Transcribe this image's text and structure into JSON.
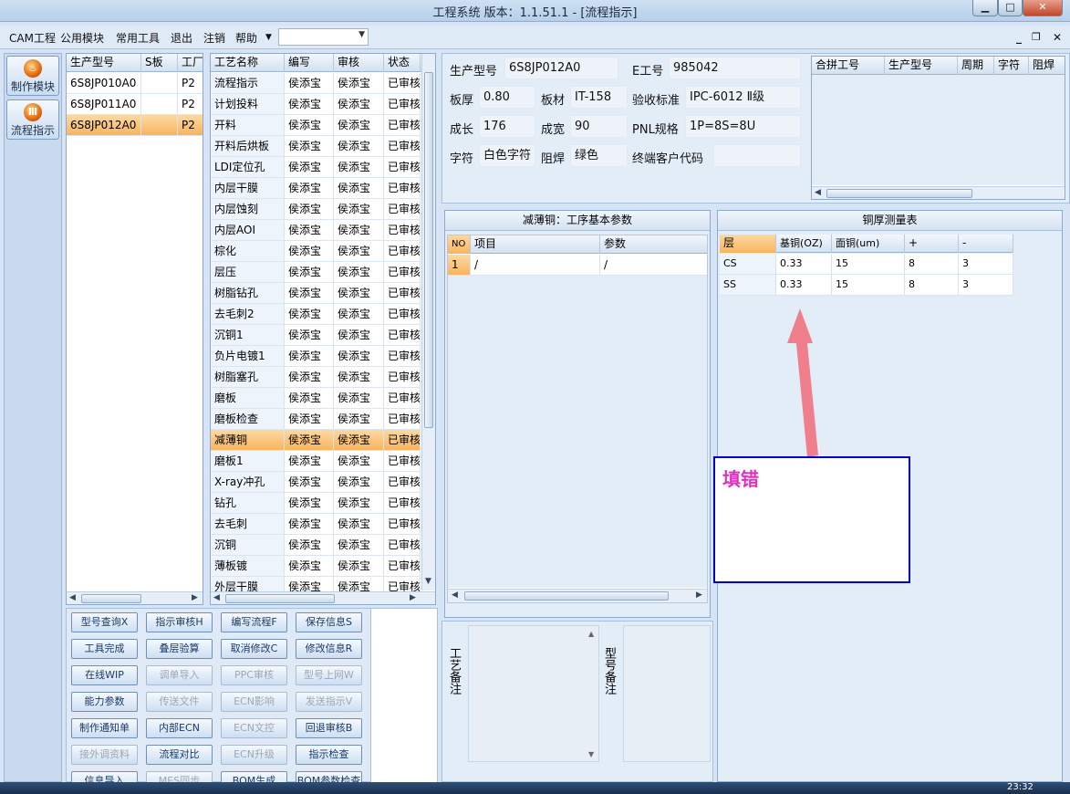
{
  "window": {
    "title": "工程系统  版本：1.1.51.1 - [流程指示]"
  },
  "menu": {
    "items": [
      "CAM工程",
      "公用模块",
      "常用工具",
      "退出",
      "注销",
      "帮助"
    ],
    "combo_value": ""
  },
  "nav": {
    "items": [
      "制作模块",
      "流程指示"
    ]
  },
  "model_grid": {
    "headers": [
      "生产型号",
      "S板",
      "工厂"
    ],
    "rows": [
      [
        "6S8JP010A0",
        "",
        "P2"
      ],
      [
        "6S8JP011A0",
        "",
        "P2"
      ],
      [
        "6S8JP012A0",
        "",
        "P2"
      ]
    ],
    "selected_index": 2
  },
  "process_grid": {
    "headers": [
      "工艺名称",
      "编写",
      "审核",
      "状态"
    ],
    "rows": [
      [
        "流程指示",
        "侯添宝",
        "侯添宝",
        "已审核"
      ],
      [
        "计划投料",
        "侯添宝",
        "侯添宝",
        "已审核"
      ],
      [
        "开料",
        "侯添宝",
        "侯添宝",
        "已审核"
      ],
      [
        "开料后烘板",
        "侯添宝",
        "侯添宝",
        "已审核"
      ],
      [
        "LDI定位孔",
        "侯添宝",
        "侯添宝",
        "已审核"
      ],
      [
        "内层干膜",
        "侯添宝",
        "侯添宝",
        "已审核"
      ],
      [
        "内层蚀刻",
        "侯添宝",
        "侯添宝",
        "已审核"
      ],
      [
        "内层AOI",
        "侯添宝",
        "侯添宝",
        "已审核"
      ],
      [
        "棕化",
        "侯添宝",
        "侯添宝",
        "已审核"
      ],
      [
        "层压",
        "侯添宝",
        "侯添宝",
        "已审核"
      ],
      [
        "树脂钻孔",
        "侯添宝",
        "侯添宝",
        "已审核"
      ],
      [
        "去毛刺2",
        "侯添宝",
        "侯添宝",
        "已审核"
      ],
      [
        "沉铜1",
        "侯添宝",
        "侯添宝",
        "已审核"
      ],
      [
        "负片电镀1",
        "侯添宝",
        "侯添宝",
        "已审核"
      ],
      [
        "树脂塞孔",
        "侯添宝",
        "侯添宝",
        "已审核"
      ],
      [
        "磨板",
        "侯添宝",
        "侯添宝",
        "已审核"
      ],
      [
        "磨板检查",
        "侯添宝",
        "侯添宝",
        "已审核"
      ],
      [
        "减薄铜",
        "侯添宝",
        "侯添宝",
        "已审核"
      ],
      [
        "磨板1",
        "侯添宝",
        "侯添宝",
        "已审核"
      ],
      [
        "X-ray冲孔",
        "侯添宝",
        "侯添宝",
        "已审核"
      ],
      [
        "钻孔",
        "侯添宝",
        "侯添宝",
        "已审核"
      ],
      [
        "去毛刺",
        "侯添宝",
        "侯添宝",
        "已审核"
      ],
      [
        "沉铜",
        "侯添宝",
        "侯添宝",
        "已审核"
      ],
      [
        "薄板镀",
        "侯添宝",
        "侯添宝",
        "已审核"
      ],
      [
        "外层干膜",
        "侯添宝",
        "侯添宝",
        "已审核"
      ]
    ],
    "selected_index": 17
  },
  "buttons": [
    [
      "型号查询X",
      "指示审核H",
      "编写流程F",
      "保存信息S"
    ],
    [
      "工具完成",
      "叠层验算",
      "取消修改C",
      "修改信息R"
    ],
    [
      "在线WIP",
      "调单导入",
      "PPC审核",
      "型号上网W"
    ],
    [
      "能力参数",
      "传送文件",
      "ECN影响",
      "发送指示V"
    ],
    [
      "制作通知单",
      "内部ECN",
      "ECN文控",
      "回退审核B"
    ],
    [
      "接外调资料",
      "流程对比",
      "ECN升级",
      "指示检查"
    ],
    [
      "信息导入",
      "MES同步",
      "BOM生成",
      "BOM参数检查"
    ]
  ],
  "buttons_disabled": [
    "调单导入",
    "PPC审核",
    "型号上网W",
    "传送文件",
    "ECN影响",
    "发送指示V",
    "ECN文控",
    "接外调资料",
    "ECN升级",
    "MES同步"
  ],
  "info": {
    "model_label": "生产型号",
    "model_value": "6S8JP012A0",
    "e_label": "E工号",
    "e_value": "985042",
    "thickness_label": "板厚",
    "thickness_value": "0.80",
    "material_label": "板材",
    "material_value": "IT-158",
    "standard_label": "验收标准",
    "standard_value": "IPC-6012 Ⅱ级",
    "length_label": "成长",
    "length_value": "176",
    "width_label": "成宽",
    "width_value": "90",
    "pnl_label": "PNL规格",
    "pnl_value": "1P=8S=8U",
    "char_label": "字符",
    "char_value": "白色字符",
    "mask_label": "阻焊",
    "mask_value": "绿色",
    "customer_label": "终端客户代码",
    "customer_value": ""
  },
  "merge_grid": {
    "headers": [
      "合拼工号",
      "生产型号",
      "周期",
      "字符",
      "阻焊"
    ]
  },
  "param_panel": {
    "title": "减薄铜：工序基本参数",
    "headers": [
      "NO",
      "项目",
      "参数"
    ],
    "rows": [
      [
        "1",
        "/",
        "/"
      ]
    ]
  },
  "copper_panel": {
    "title": "铜厚测量表",
    "headers": [
      "层",
      "基铜(OZ)",
      "面铜(um)",
      "+",
      "-"
    ],
    "rows": [
      [
        "CS",
        "0.33",
        "15",
        "8",
        "3"
      ],
      [
        "SS",
        "0.33",
        "15",
        "8",
        "3"
      ]
    ]
  },
  "remarks": {
    "process_label": "工艺备注",
    "model_label": "型号备注"
  },
  "annotation": {
    "text": "填错"
  },
  "taskbar": {
    "clock": "23:32"
  }
}
